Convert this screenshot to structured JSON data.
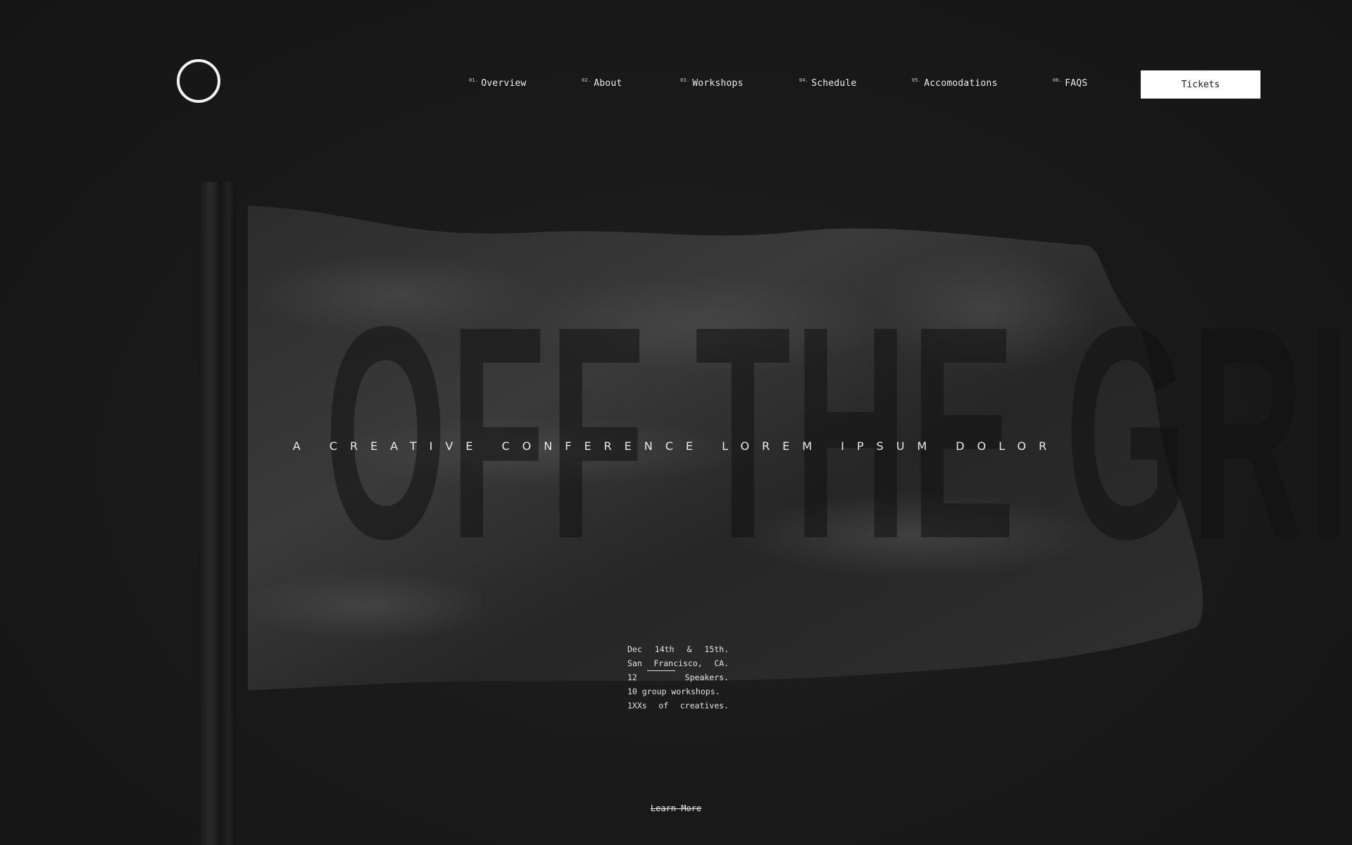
{
  "header": {
    "logo_icon": "circle-logo-icon",
    "nav": [
      {
        "num": "01.",
        "label": "Overview"
      },
      {
        "num": "02.",
        "label": "About"
      },
      {
        "num": "03.",
        "label": "Workshops"
      },
      {
        "num": "04.",
        "label": "Schedule"
      },
      {
        "num": "05.",
        "label": "Accomodations"
      },
      {
        "num": "06.",
        "label": "FAQS"
      }
    ],
    "tickets_label": "Tickets"
  },
  "hero": {
    "headline": "OFF THE GRID",
    "tagline": "A CREATIVE CONFERENCE LOREM IPSUM DOLOR",
    "details": {
      "line1": [
        "Dec",
        "14th",
        "&",
        "15th."
      ],
      "line2": [
        "San",
        "Francisco,",
        "CA."
      ],
      "line3_start": "12",
      "line3_end": "Speakers.",
      "line4": "10 group workshops.",
      "line5": [
        "1XXs",
        "of",
        "creatives."
      ]
    },
    "learn_more": "Learn More"
  },
  "colors": {
    "background": "#181818",
    "text": "#e8e8e8",
    "button_bg": "#ffffff",
    "button_text": "#1a1a1a"
  }
}
